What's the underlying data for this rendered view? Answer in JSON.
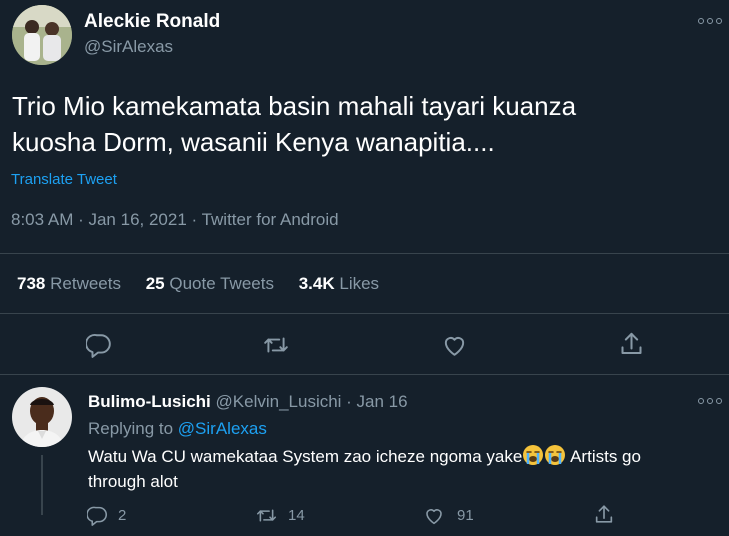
{
  "tweet": {
    "author_name": "Aleckie Ronald",
    "author_handle": "@SirAlexas",
    "text_line1": "Trio Mio kamekamata basin mahali tayari kuanza",
    "text_line2": "kuosha Dorm, wasanii Kenya wanapitia....",
    "translate_label": "Translate Tweet",
    "timestamp": "8:03 AM · Jan 16, 2021 · Twitter for Android",
    "stats": {
      "retweets_count": "738",
      "retweets_label": "Retweets",
      "quotes_count": "25",
      "quotes_label": "Quote Tweets",
      "likes_count": "3.4K",
      "likes_label": "Likes"
    },
    "actions": [
      "reply-icon",
      "retweet-icon",
      "like-icon",
      "share-icon"
    ]
  },
  "reply": {
    "author_name": "Bulimo-Lusichi",
    "meta": "@Kelvin_Lusichi · Jan 16",
    "replying_prefix": "Replying to",
    "replying_handle": "@SirAlexas",
    "text_line1": "Watu Wa CU wamekataa System zao icheze ngoma yake",
    "text_line1_end": " Artists go",
    "text_line2": "through alot",
    "emoji": [
      "crying-face-emoji",
      "crying-face-emoji"
    ],
    "reply_count": "2",
    "retweet_count": "14",
    "like_count": "91"
  },
  "colors": {
    "background": "#15202b",
    "text": "#ffffff",
    "muted": "#8899a6",
    "accent": "#1da1f2",
    "divider": "#38444d"
  }
}
